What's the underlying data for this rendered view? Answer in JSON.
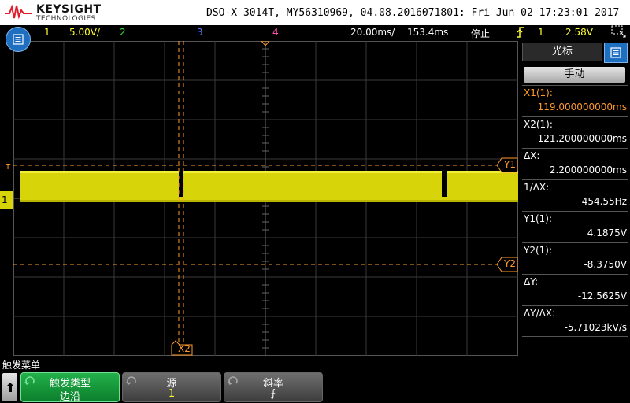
{
  "header": {
    "brand": "KEYSIGHT",
    "brand_sub": "TECHNOLOGIES",
    "instrument_id": "DSO-X 3014T, MY56310969, 04.08.2016071801: Fri Jun 02 17:23:01 2017"
  },
  "status_bar": {
    "ch1_num": "1",
    "ch1_scale": "5.00V/",
    "ch2_num": "2",
    "ch3_num": "3",
    "ch4_num": "4",
    "timebase": "20.00ms/",
    "delay": "153.4ms",
    "run_state": "停止",
    "trigger_source": "1",
    "trigger_level": "2.58V"
  },
  "colors": {
    "ch1": "#ffff33",
    "ch2": "#2ee82e",
    "ch3": "#5c7cff",
    "ch4": "#ff4fb0",
    "cursor": "#ff9a2a",
    "softkey_active": "#23b04a",
    "menu_button": "#1f6fc1"
  },
  "scope": {
    "ch1_marker": "1",
    "trigger_marker": "T",
    "cursor_x2_label": "X2",
    "cursor_y1_label": "Y1",
    "cursor_y2_label": "Y2"
  },
  "cursor_panel": {
    "title": "光标",
    "mode_button": "手动",
    "readouts": [
      {
        "label": "X1(1):",
        "value": "119.000000000ms",
        "active": true
      },
      {
        "label": "X2(1):",
        "value": "121.200000000ms",
        "active": false
      },
      {
        "label": "ΔX:",
        "value": "2.200000000ms",
        "active": false
      },
      {
        "label": "1/ΔX:",
        "value": "454.55Hz",
        "active": false
      },
      {
        "label": "Y1(1):",
        "value": "4.1875V",
        "active": false
      },
      {
        "label": "Y2(1):",
        "value": "-8.3750V",
        "active": false
      },
      {
        "label": "ΔY:",
        "value": "-12.5625V",
        "active": false
      },
      {
        "label": "ΔY/ΔX:",
        "value": "-5.71023kV/s",
        "active": false
      }
    ]
  },
  "softkeys": {
    "menu_title": "触发菜单",
    "keys": [
      {
        "title": "触发类型",
        "value": "边沿"
      },
      {
        "title": "源",
        "value": "1"
      },
      {
        "title": "斜率",
        "value": "⨍"
      }
    ]
  }
}
